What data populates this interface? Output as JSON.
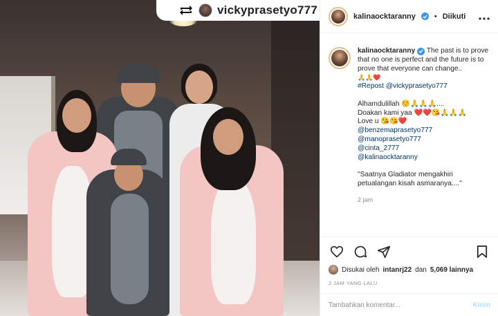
{
  "photo": {
    "repost_username": "vickyprasetyo777"
  },
  "header": {
    "username": "kalinaocktaranny",
    "separator": "•",
    "follow_state": "Diikuti",
    "more_icon": "more-horizontal-icon"
  },
  "caption": {
    "author": "kalinaocktaranny",
    "lines": [
      "The past is to prove that no one is perfect and the future is to prove that everyone can change..",
      "🙏🙏❤️",
      "#Repost @vickyprasetyo777",
      "",
      "Alhamdulillah ☺️🙏🙏🙏....",
      "Doakan kami yaa ❤️❤️😘🙏🙏🙏",
      "Love u 😘😘❤️",
      "@benzemaprasetyo777",
      "@manoprasetyo777",
      "@cinta_2777",
      "@kalinaocktaranny",
      "",
      "\"Saatnya Gladiator mengakhiri petualangan kisah asmaranya....\""
    ],
    "time": "2 jam"
  },
  "actions": {
    "like_icon": "heart-icon",
    "comment_icon": "comment-icon",
    "share_icon": "send-icon",
    "save_icon": "bookmark-icon",
    "likes_prefix": "Disukai oleh",
    "liker": "intanrj22",
    "likes_and": "dan",
    "likes_count": "5,069 lainnya",
    "timestamp": "2 JAM YANG LALU"
  },
  "comment": {
    "placeholder": "Tambahkan komentar...",
    "post_label": "Kirim"
  },
  "colors": {
    "verified": "#3897f0",
    "link": "#003569",
    "post_disabled": "#b2dffc"
  }
}
